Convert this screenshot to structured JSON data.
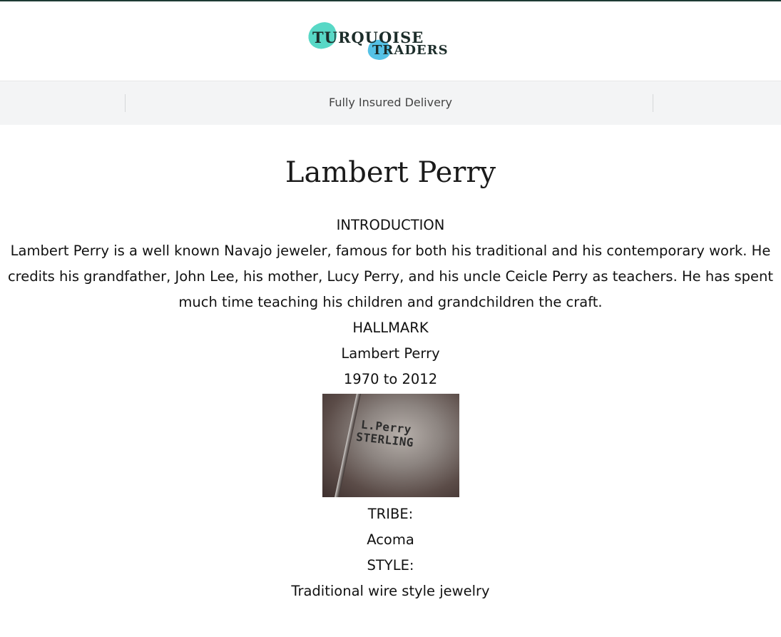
{
  "brand": {
    "line1": "TURQUOISE",
    "line2": "TRADERS"
  },
  "announcement": {
    "text": "Fully Insured Delivery"
  },
  "page": {
    "title": "Lambert Perry",
    "introduction_heading": "INTRODUCTION",
    "introduction_text": "Lambert Perry is a well known Navajo jeweler, famous for both his traditional and his contemporary work. He credits his grandfather, John Lee, his mother, Lucy Perry, and his uncle Ceicle Perry as teachers. He has spent much time teaching his children and grandchildren the craft.",
    "hallmark_heading": "HALLMARK",
    "hallmark_name": "Lambert Perry",
    "hallmark_years": "1970 to 2012",
    "hallmark_stamp": {
      "line1": "L.Perry",
      "line2": "STERLING"
    },
    "tribe_heading": "TRIBE:",
    "tribe_value": "Acoma",
    "style_heading": "STYLE:",
    "style_value": "Traditional wire style jewelry"
  }
}
